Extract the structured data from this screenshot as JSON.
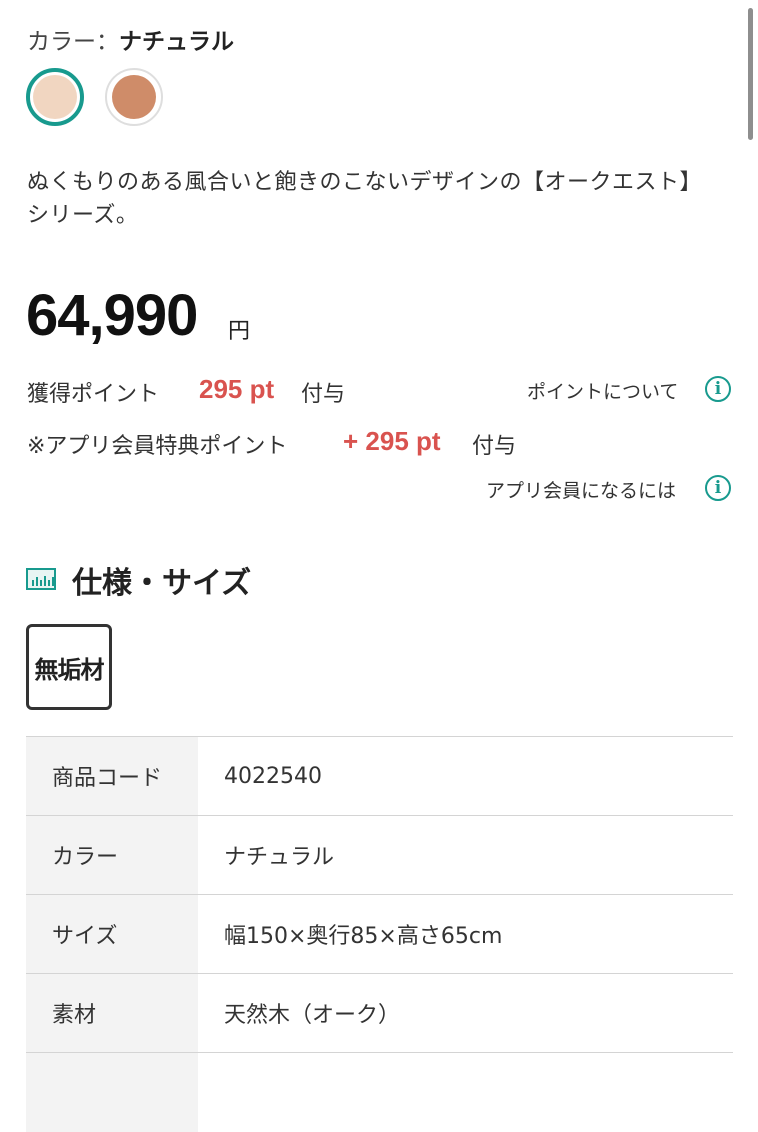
{
  "color": {
    "label": "カラー：",
    "selected": "ナチュラル",
    "swatches": [
      {
        "name": "ナチュラル",
        "hex": "#f1d6c1",
        "selected": true
      },
      {
        "name": "ブラウン",
        "hex": "#cf8c69",
        "selected": false
      }
    ],
    "selected_ring_color": "#189a8e"
  },
  "description": "ぬくもりのある風合いと飽きのこないデザインの【オークエスト】シリーズ。",
  "price": {
    "amount": "64,990",
    "unit": "円"
  },
  "points": {
    "earned_label": "獲得ポイント",
    "earned_value": "295 pt",
    "earned_suffix": "付与",
    "about_link": "ポイントについて",
    "app_label": "※アプリ会員特典ポイント",
    "app_value": "+ 295 pt",
    "app_suffix": "付与",
    "app_link": "アプリ会員になるには",
    "accent_color": "#d9534f"
  },
  "spec": {
    "title": "仕様・サイズ",
    "badge": "無垢材",
    "rows": [
      {
        "label": "商品コード",
        "value": "4022540"
      },
      {
        "label": "カラー",
        "value": "ナチュラル"
      },
      {
        "label": "サイズ",
        "value": "幅150×奥行85×高さ65cm"
      },
      {
        "label": "素材",
        "value": "天然木（オーク）"
      },
      {
        "label": "",
        "value": ""
      }
    ]
  },
  "icons": {
    "info": "info-icon",
    "section": "ruler-chart-icon"
  }
}
